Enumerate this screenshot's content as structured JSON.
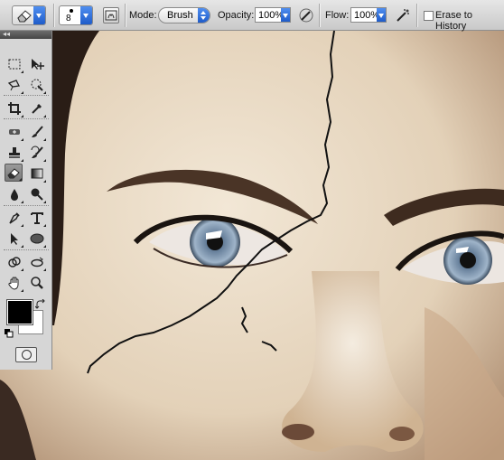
{
  "options_bar": {
    "brush_size": "8",
    "mode_label": "Mode:",
    "mode_value": "Brush",
    "opacity_label": "Opacity:",
    "opacity_value": "100%",
    "flow_label": "Flow:",
    "flow_value": "100%",
    "erase_to_history_label": "Erase to History",
    "erase_to_history_checked": false
  },
  "toolbox": {
    "tools": [
      {
        "name": "marquee-tool-icon"
      },
      {
        "name": "move-tool-icon"
      },
      {
        "name": "lasso-tool-icon"
      },
      {
        "name": "quick-selection-tool-icon"
      },
      {
        "name": "crop-tool-icon"
      },
      {
        "name": "eyedropper-tool-icon"
      },
      {
        "name": "healing-brush-tool-icon"
      },
      {
        "name": "brush-tool-icon"
      },
      {
        "name": "clone-stamp-tool-icon"
      },
      {
        "name": "history-brush-tool-icon"
      },
      {
        "name": "eraser-tool-icon",
        "active": true
      },
      {
        "name": "gradient-tool-icon"
      },
      {
        "name": "blur-tool-icon"
      },
      {
        "name": "dodge-tool-icon"
      },
      {
        "name": "pen-tool-icon"
      },
      {
        "name": "type-tool-icon"
      },
      {
        "name": "path-selection-tool-icon"
      },
      {
        "name": "ellipse-tool-icon"
      },
      {
        "name": "3d-rotate-tool-icon"
      },
      {
        "name": "3d-orbit-tool-icon"
      },
      {
        "name": "hand-tool-icon"
      },
      {
        "name": "zoom-tool-icon"
      }
    ],
    "foreground_color": "#000000",
    "background_color": "#ffffff"
  },
  "colors": {
    "accent": "#2a6fe0",
    "skin": "#e7d8c3",
    "crack": "#111111",
    "iris": "#7b93ad"
  }
}
